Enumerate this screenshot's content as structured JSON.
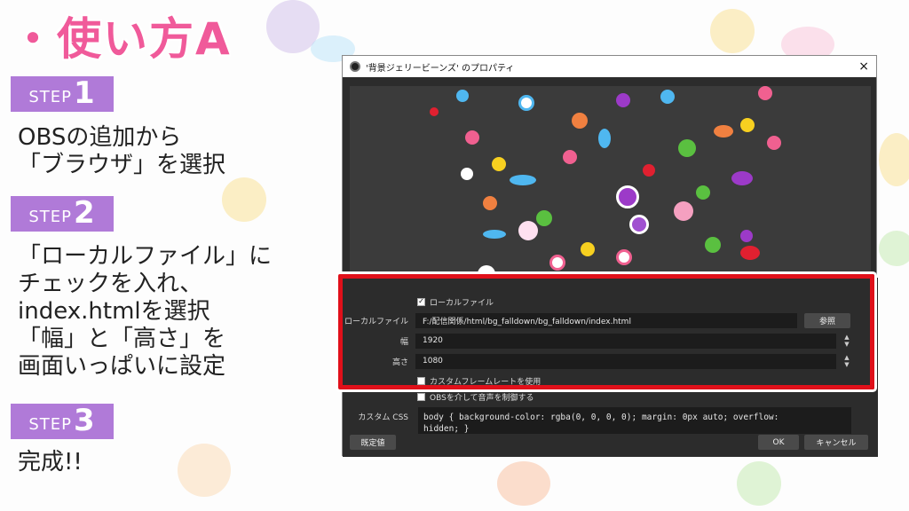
{
  "title": "・使い方A",
  "steps": [
    {
      "label": "STEP",
      "num": "1",
      "text": "OBSの追加から\n「ブラウザ」を選択"
    },
    {
      "label": "STEP",
      "num": "2",
      "text": "「ローカルファイル」に\nチェックを入れ、\nindex.htmlを選択\n「幅」と「高さ」を\n画面いっぱいに設定"
    },
    {
      "label": "STEP",
      "num": "3",
      "text": "完成!!"
    }
  ],
  "dialog": {
    "title": "'背景ジェリービーンズ' のプロパティ",
    "close_icon": "×",
    "local_file_check_label": "ローカルファイル",
    "local_file_checked": true,
    "local_file_label": "ローカルファイル",
    "local_file_value": "F:/配信関係/html/bg_falldown/bg_falldown/index.html",
    "browse_label": "参照",
    "width_label": "幅",
    "width_value": "1920",
    "height_label": "高さ",
    "height_value": "1080",
    "custom_fps_label": "カスタムフレームレートを使用",
    "obs_audio_label": "OBSを介して音声を制御する",
    "custom_css_label": "カスタム CSS",
    "custom_css_value": "body { background-color: rgba(0, 0, 0, 0); margin: 0px auto; overflow:\nhidden; }",
    "defaults_label": "既定値",
    "ok_label": "OK",
    "cancel_label": "キャンセル"
  },
  "colors": {
    "title_pink": "#f05a9a",
    "step_purple": "#b07ad8",
    "highlight_red": "#e0101a"
  }
}
